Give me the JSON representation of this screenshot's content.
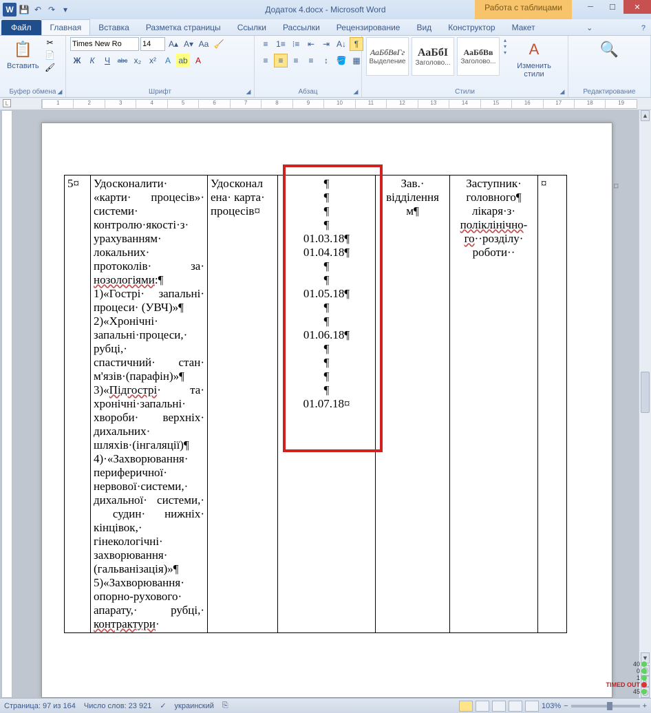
{
  "title": "Додаток 4.docx - Microsoft Word",
  "context_tab": "Работа с таблицами",
  "file_tab": "Файл",
  "tabs": [
    "Главная",
    "Вставка",
    "Разметка страницы",
    "Ссылки",
    "Рассылки",
    "Рецензирование",
    "Вид",
    "Конструктор",
    "Макет"
  ],
  "ribbon": {
    "clipboard": {
      "paste": "Вставить",
      "label": "Буфер обмена"
    },
    "font": {
      "name": "Times New Ro",
      "size": "14",
      "label": "Шрифт",
      "bold": "Ж",
      "italic": "К",
      "underline": "Ч",
      "strike": "abc",
      "sub": "x₂",
      "sup": "x²"
    },
    "paragraph": {
      "label": "Абзац"
    },
    "styles": {
      "label": "Стили",
      "preview": "АаБбВвГг",
      "preview_big": "АаБбІ",
      "preview_bold": "АаБбВв",
      "s1": "Выделение",
      "s2": "Заголово...",
      "s3": "Заголово...",
      "change": "Изменить стили"
    },
    "editing": {
      "label": "Редактирование"
    }
  },
  "ruler_corner": "L",
  "table": {
    "row_num": "5¤",
    "col2": "Удосконалити· «карти· процесів»· системи· контролю·якості·з· урахуванням· локальних· протоколів·   за· нозологіями:¶\n1)«Гострі· запальні· процеси· (УВЧ)»¶\n2)«Хронічні· запальні·процеси,· рубці,· спастичний· стан· м'язів·(парафін)»¶\n3)«Підгострі·  та· хронічні·запальні· хвороби· верхніх· дихальних· шляхів·(інгаляції)¶\n4)·«Захворювання· периферичної· нервової·системи,· дихальної· системи,·  судин· нижніх· кінцівок,· гінекологічні· захворювання· (гальванізація)»¶\n5)«Захворювання· опорно-рухового· апарату,·  рубці,· контрактури·",
    "col3": "Удосконал\nена· карта·\nпроцесів¤",
    "col4_lines": [
      "¶",
      "¶",
      "¶",
      "¶",
      "01.03.18¶",
      "01.04.18¶",
      "¶",
      "¶",
      "01.05.18¶",
      "¶",
      "¶",
      "01.06.18¶",
      "¶",
      "¶",
      "¶",
      "¶",
      "01.07.18¤"
    ],
    "col5": "Зав.·\nвідділення\nм¶",
    "col6": "Заступник·\nголовного¶\nлікаря·з·\nполіклінічно-\nго··розділу·\nроботи··",
    "col7": "¤"
  },
  "status": {
    "page": "Страница: 97 из 164",
    "words": "Число слов: 23 921",
    "lang": "украинский",
    "zoom": "103%"
  },
  "indicators": {
    "i1": "40",
    "i2": "0",
    "i3": "1",
    "i4": "45",
    "timed": "TIMED OUT"
  }
}
